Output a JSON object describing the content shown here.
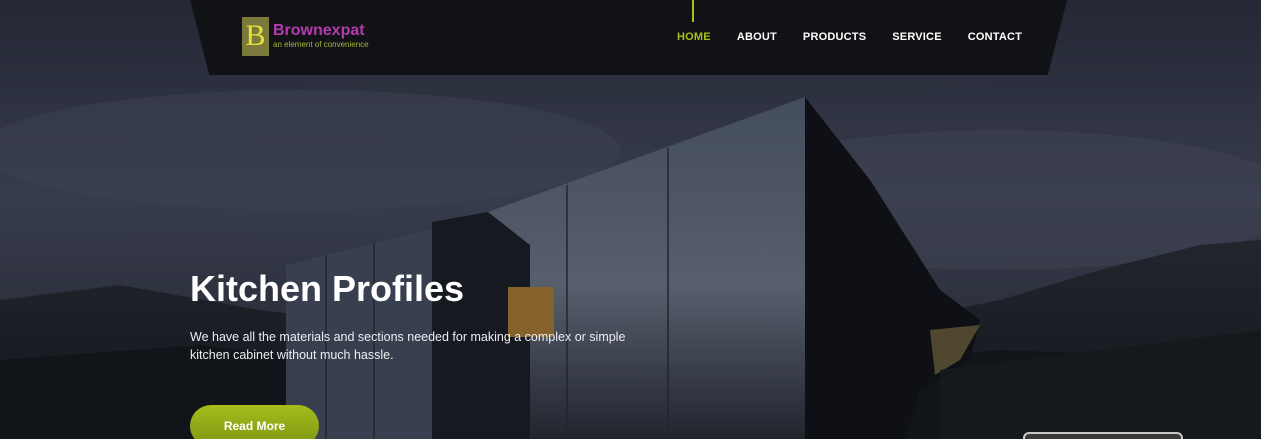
{
  "brand": {
    "logo_letter": "B",
    "name": "Brownexpat",
    "tagline": "an element of convenience"
  },
  "nav": {
    "items": [
      {
        "label": "HOME",
        "active": true
      },
      {
        "label": "ABOUT",
        "active": false
      },
      {
        "label": "PRODUCTS",
        "active": false
      },
      {
        "label": "SERVICE",
        "active": false
      },
      {
        "label": "CONTACT",
        "active": false
      }
    ]
  },
  "hero": {
    "title": "Kitchen Profiles",
    "description": "We have all the materials and sections needed for making a complex or simple kitchen cabinet without much hassle.",
    "cta_label": "Read More"
  },
  "colors": {
    "accent": "#a4c21a",
    "brand_purple": "#b63bb0",
    "header_bg": "#111215"
  },
  "icons": {
    "logo": "brownexpat-logo-icon"
  }
}
